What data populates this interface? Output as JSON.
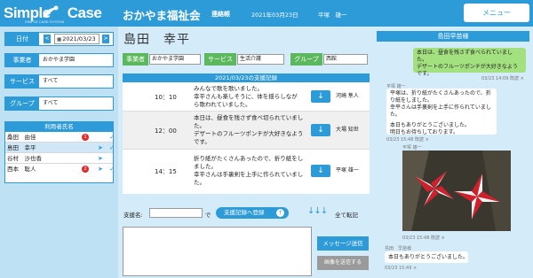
{
  "app": {
    "logo_text": "Simple",
    "logo_text2": "Case",
    "logo_sub": "SIMPLE CASE SYSTEM",
    "org_name": "おかやま福祉会",
    "contact_link": "連絡帳",
    "datetime": "2021年03月23日",
    "staff": "平塚　雄一",
    "menu_label": "メニュー",
    "brand_color": "#2e9bd9"
  },
  "sidebar": {
    "date_label": "日付",
    "date_value": "2021/03/23",
    "prev_icon": "<",
    "next_icon": ">",
    "office_label": "事業者",
    "office_value": "おかやま学園",
    "service_label": "サービス",
    "service_value": "すべて",
    "group_label": "グループ",
    "group_value": "すべて",
    "users_header": "利用者氏名",
    "users": [
      {
        "name": "桑田　由佳",
        "badge": "1",
        "plane": "",
        "check": "✓"
      },
      {
        "name": "島田　幸平",
        "badge": "",
        "plane": "➤",
        "check": "✓"
      },
      {
        "name": "谷村　沙也香",
        "badge": "",
        "plane": "➤",
        "check": ""
      },
      {
        "name": "西本　聡人",
        "badge": "2",
        "plane": "➤",
        "check": "✓"
      }
    ]
  },
  "main": {
    "person_name": "島田　幸平",
    "office_label": "事業者",
    "office_value": "おかやま学園",
    "service_label": "サービス",
    "service_value": "生活介護",
    "group_label": "グループ",
    "group_value": "西館",
    "records_header": "2021/03/23の支援記録",
    "records": [
      {
        "time": "10：10",
        "lines": [
          "みんなで歌を歌いました。",
          "幸平さんも楽しそうに、体を揺らしなが",
          "ら歌われていました。"
        ],
        "staff": [
          "河崎 隼人"
        ]
      },
      {
        "time": "12：00",
        "lines": [
          "本日は、昼食を残さず食べ切られていまし",
          "た。",
          "デザートのフルーツポンチが大好きなよう",
          "です。"
        ],
        "staff": [
          "大場 知世"
        ]
      },
      {
        "time": "14：15",
        "lines": [
          "折り紙がたくさんあったので、折り紙をし",
          "ました。",
          "幸平さんは手裏剣を上手に作られていまし",
          "た。"
        ],
        "staff": [
          "平塚 雄一"
        ]
      }
    ],
    "supporter_label": "支援名:",
    "de": "で",
    "register_label": "支援記録へ登録",
    "transfer_label": "全て転記",
    "send_message_label": "メッセージ送信",
    "send_image_label": "画像を送信する"
  },
  "chat": {
    "header": "島田早苗様",
    "msg1": [
      "本日は、昼食を残さず食べられていました。",
      "デザートのフルーツポンチが大好きなようです。"
    ],
    "msg1_stamp": "03/23 14:09 既読 ×",
    "msg2_name": "平塚 雄一",
    "msg2": [
      "平塚は、折り紙がたくさんあったので、折り紙をしました。",
      "幸平さんは手裏剣を上手に作られていました。",
      "",
      "本日もありがとうございました。",
      "明日もお待ちしております。"
    ],
    "msg2_stamp": "03/23 15:48 既読 ×",
    "photo_name": "平塚 雄一",
    "photo_stamp": "03/23 15:48 既読 ×",
    "msg3_name": "島田　早苗様",
    "msg3": "本日もありがとうございました。",
    "msg3_stamp": "03/23 15:49 ×"
  }
}
